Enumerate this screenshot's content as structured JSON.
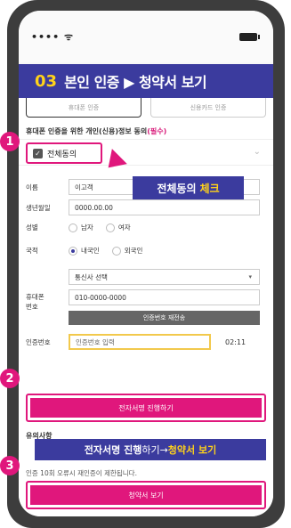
{
  "status": {
    "signal": "••••  ᯤ"
  },
  "title": {
    "number": "03",
    "text": "본인 인증 ▶ 청약서 보기"
  },
  "tabs": [
    {
      "label": "휴대폰 인증"
    },
    {
      "label": "신용카드 인증"
    }
  ],
  "consent": {
    "title": "휴대폰 인증을 위한 개인(신용)정보 동의",
    "required": "(필수)",
    "all_agree_label": "전체동의",
    "all_agree_checked": true
  },
  "callouts": {
    "check_text": "전체동의",
    "check_highlight": "체크",
    "sign_bold": "전자서명 진행",
    "sign_rest": "하기→",
    "sign_bold2": "청약서 보기"
  },
  "form": {
    "name_label": "이름",
    "name_value": "이고객",
    "birth_label": "생년월일",
    "birth_value": "0000.00.00",
    "gender_label": "성별",
    "gender_options": [
      "남자",
      "여자"
    ],
    "nationality_label": "국적",
    "nationality_options": [
      "내국인",
      "외국인"
    ],
    "nationality_selected": "내국인",
    "phone_label_1": "휴대폰",
    "phone_label_2": "번호",
    "carrier_value": "통신사 선택",
    "phone_value": "010-0000-0000",
    "resend_label": "인증번호 재전송",
    "auth_label": "인증번호",
    "auth_placeholder": "인증번호 입력",
    "timer": "02:11"
  },
  "buttons": {
    "sign": "전자서명 진행하기",
    "terms": "청약서 보기"
  },
  "notice": {
    "title": "유의사항",
    "text": "인증 10회 오류시 재인증이 제한됩니다."
  },
  "badges": [
    "1",
    "2",
    "3"
  ],
  "colors": {
    "accent": "#e0177c",
    "header": "#3b3b9e",
    "highlight": "#ffd21a"
  }
}
